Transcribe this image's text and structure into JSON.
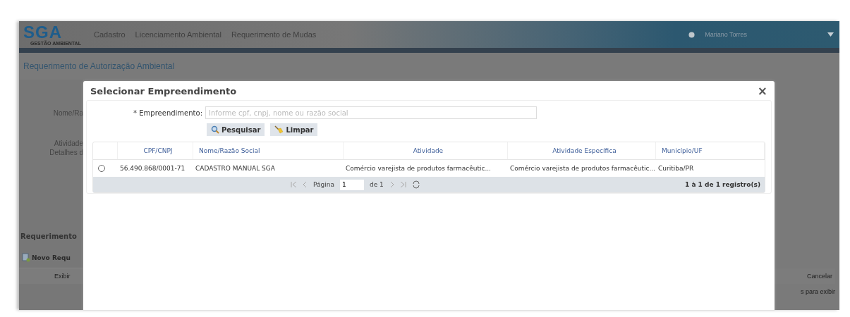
{
  "header": {
    "logo": {
      "title": "SGA",
      "subtitle": "GESTÃO AMBIENTAL"
    },
    "menu": [
      "Cadastro",
      "Licenciamento Ambiental",
      "Requerimento de Mudas"
    ],
    "user": "Mariano Torres"
  },
  "page_title": "Requerimento de Autorização Ambiental",
  "background_left": {
    "labels": [
      "Nome/Ra",
      "Atividade",
      "Detalhes d"
    ],
    "section_title": "Requerimento",
    "new_button": "Novo Requ",
    "column": "Exibir"
  },
  "background_right": {
    "column": "Cancelar",
    "empty_text": "s para exibir"
  },
  "dialog": {
    "title": "Selecionar Empreendimento",
    "close": "×",
    "field": {
      "label": "* Empreendimento:",
      "placeholder": "Informe cpf, cnpj, nome ou razão social"
    },
    "buttons": [
      {
        "kind": "search",
        "label": "Pesquisar"
      },
      {
        "kind": "clear",
        "label": "Limpar"
      }
    ],
    "table": {
      "columns": [
        "CPF/CNPJ",
        "Nome/Razão Social",
        "Atividade",
        "Atividade Específica",
        "Município/UF"
      ],
      "rows": [
        {
          "selected": false,
          "cells": [
            "56.490.868/0001-71",
            "CADASTRO MANUAL SGA",
            "Comércio varejista de produtos farmacêutic...",
            "Comércio varejista de produtos farmacêutic...",
            "Curitiba/PR"
          ]
        }
      ]
    },
    "pager": {
      "page_label": "Página",
      "page": "1",
      "of": "de 1",
      "summary": "1 à 1 de 1 registro(s)"
    }
  }
}
